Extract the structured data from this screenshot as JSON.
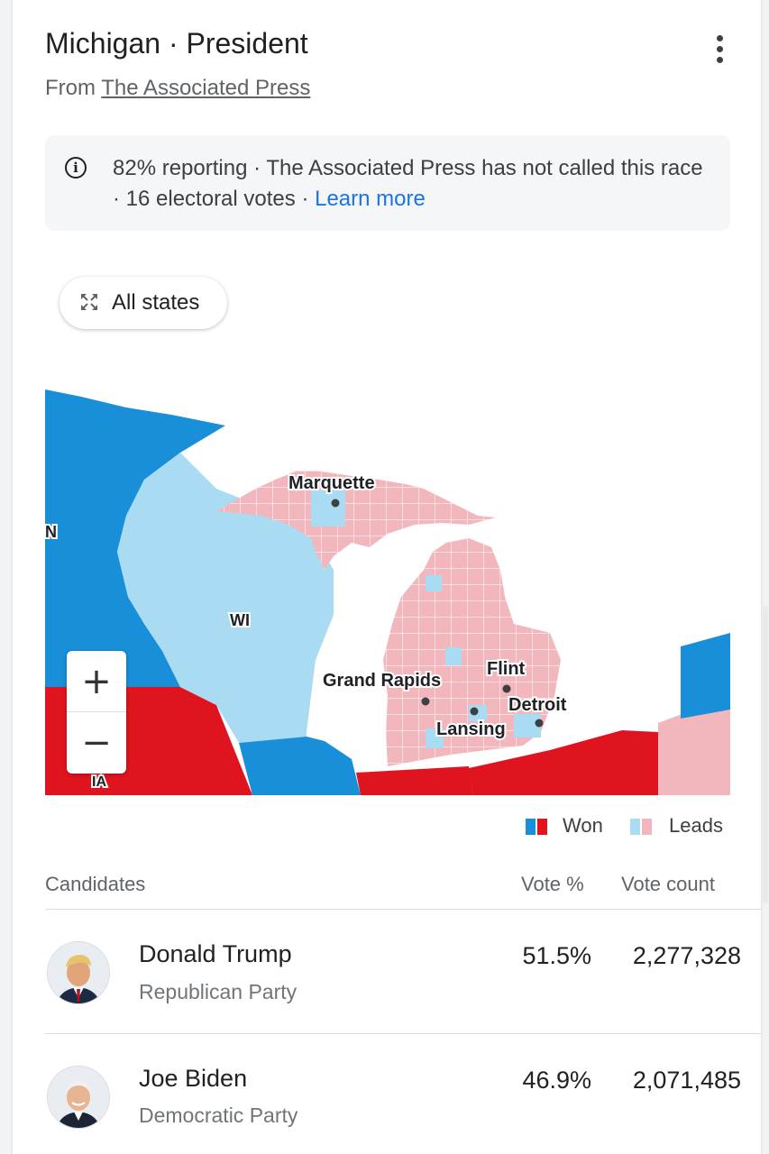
{
  "header": {
    "title": "Michigan · President",
    "source_prefix": "From ",
    "source_link": "The Associated Press"
  },
  "notice": {
    "text": "82% reporting · The Associated Press has not called this race · 16 electoral votes · ",
    "link": "Learn more"
  },
  "map": {
    "all_states_label": "All states",
    "labels": {
      "marquette": "Marquette",
      "wi": "WI",
      "mn": "N",
      "grand_rapids": "Grand Rapids",
      "flint": "Flint",
      "detroit": "Detroit",
      "lansing": "Lansing",
      "ia": "IA"
    },
    "zoom_in": "+",
    "zoom_out": "−",
    "colors": {
      "dem_won": "#1a8fd9",
      "dem_leads": "#a9dcf2",
      "rep_won": "#e0141e",
      "rep_leads": "#f2b6bd",
      "water": "#ffffff"
    }
  },
  "legend": {
    "won": "Won",
    "leads": "Leads"
  },
  "table": {
    "headers": {
      "candidates": "Candidates",
      "vote_pct": "Vote %",
      "vote_count": "Vote count"
    },
    "rows": [
      {
        "name": "Donald Trump",
        "party": "Republican Party",
        "pct": "51.5%",
        "count": "2,277,328"
      },
      {
        "name": "Joe Biden",
        "party": "Democratic Party",
        "pct": "46.9%",
        "count": "2,071,485"
      }
    ]
  }
}
